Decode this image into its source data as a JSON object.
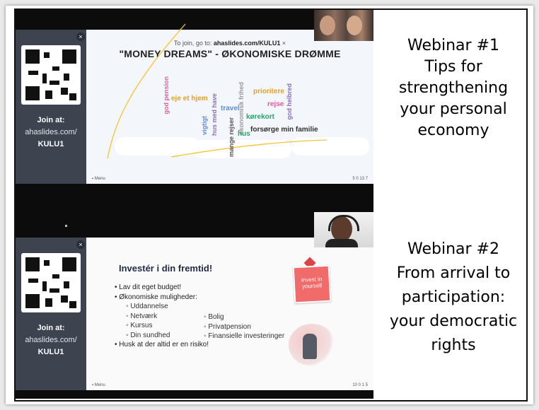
{
  "webinar1": {
    "lines": [
      "Webinar #1",
      "Tips for",
      "strengthening",
      "your personal",
      "economy"
    ],
    "join_bar": "To join, go to: ",
    "join_url": "ahaslides.com/KULU1",
    "join_close": "×",
    "slide_title": "\"MONEY DREAMS\" - ØKONOMISKE DRØMME",
    "side_join_label": "Join at:",
    "side_join_url": "ahaslides.com/",
    "side_join_code": "KULU1",
    "close_icon": "×",
    "words_horizontal": [
      {
        "text": "eje et hjem",
        "color": "#e5a21f"
      },
      {
        "text": "prioritere",
        "color": "#e5a21f"
      },
      {
        "text": "rejse",
        "color": "#e65a9b"
      },
      {
        "text": "travel",
        "color": "#5b8ed6"
      },
      {
        "text": "kørekort",
        "color": "#2aa36b"
      },
      {
        "text": "hus",
        "color": "#2aa36b"
      },
      {
        "text": "forsørge min familie",
        "color": "#333333"
      }
    ],
    "words_vertical": [
      {
        "text": "god pension",
        "color": "#e65a9b"
      },
      {
        "text": "vigtigt",
        "color": "#5b8ed6"
      },
      {
        "text": "hus med have",
        "color": "#8a6fc9"
      },
      {
        "text": "mange rejser",
        "color": "#555555"
      },
      {
        "text": "økonomisk frihed",
        "color": "#9a9a9a"
      },
      {
        "text": "god helbred",
        "color": "#8a6fc9"
      }
    ],
    "footer_menu": "Menu",
    "footer_stats": "5  0  13  7"
  },
  "webinar2": {
    "lines": [
      "Webinar #2",
      "From arrival to",
      "participation:",
      "your democratic",
      "rights"
    ],
    "slide_title": "Investér i din fremtid!",
    "bullets": [
      "Lav dit eget budget!",
      "Økonomiske muligheder:"
    ],
    "sub_col1": [
      "Uddannelse",
      "Netværk",
      "Kursus",
      "Din sundhed"
    ],
    "sub_col2": [
      "Bolig",
      "Privatpension",
      "Finansielle investeringer"
    ],
    "last_bullet": "Husk at der altid er en risiko!",
    "invest_text": "invest in yourself",
    "side_join_label": "Join at:",
    "side_join_url": "ahaslides.com/",
    "side_join_code": "KULU1",
    "close_icon": "×",
    "footer_menu": "Menu",
    "footer_stats": "10  0  1  5"
  },
  "colors": {
    "sidebar": "#3e4350",
    "bars": "#0c0c0c",
    "invest_card": "#f26b6b"
  },
  "icons": [
    "qr-code-icon",
    "close-icon",
    "menu-icon",
    "heart-icon"
  ]
}
